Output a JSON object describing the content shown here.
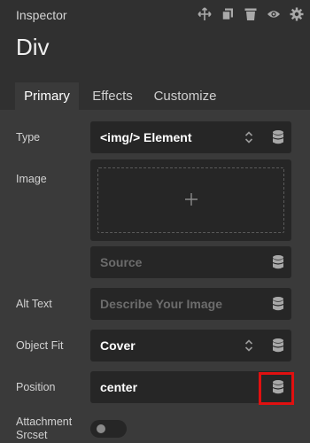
{
  "header": {
    "title": "Inspector",
    "element_name": "Div",
    "icons": [
      "move-icon",
      "copy-icon",
      "trash-icon",
      "eye-icon",
      "gear-icon"
    ]
  },
  "tabs": [
    {
      "label": "Primary",
      "active": true
    },
    {
      "label": "Effects",
      "active": false
    },
    {
      "label": "Customize",
      "active": false
    }
  ],
  "fields": {
    "type": {
      "label": "Type",
      "value": "<img/> Element"
    },
    "image": {
      "label": "Image"
    },
    "source": {
      "placeholder": "Source"
    },
    "alt_text": {
      "label": "Alt Text",
      "placeholder": "Describe Your Image"
    },
    "object_fit": {
      "label": "Object Fit",
      "value": "Cover"
    },
    "position": {
      "label": "Position",
      "value": "center"
    },
    "attachment_srcset": {
      "label_line1": "Attachment",
      "label_line2": "Srcset",
      "enabled": false
    }
  },
  "colors": {
    "background": "#3a3a3a",
    "header_bg": "#303030",
    "field_bg": "#262626",
    "highlight": "#e01010"
  }
}
